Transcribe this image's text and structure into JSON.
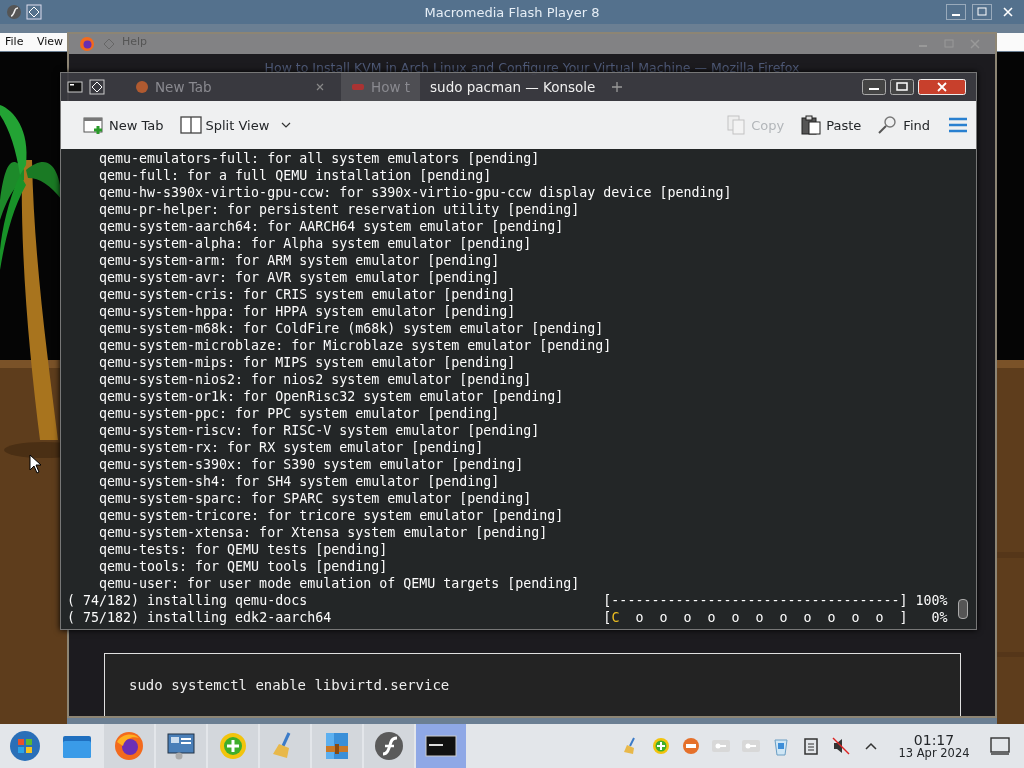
{
  "flash_window": {
    "title": "Macromedia Flash Player 8",
    "menu": [
      "File",
      "View",
      "Help"
    ]
  },
  "browser_window": {
    "title": "How to Install KVM in Arch Linux and Configure Your Virtual Machine — Mozilla Firefox",
    "code": "sudo systemctl enable libvirtd.service"
  },
  "terminal_window": {
    "title": "sudo pacman — Konsole",
    "background_tabs": [
      {
        "label": "New Tab",
        "selected": false
      },
      {
        "label": "How t",
        "selected": true
      }
    ],
    "toolbar": [
      {
        "label": "New Tab",
        "kind": "new-tab",
        "disabled": false
      },
      {
        "label": "Split View",
        "kind": "split-view",
        "disabled": false
      },
      {
        "label": "Copy",
        "kind": "copy",
        "disabled": true
      },
      {
        "label": "Paste",
        "kind": "paste",
        "disabled": false
      },
      {
        "label": "Find",
        "kind": "find",
        "disabled": false
      }
    ],
    "lines": [
      "qemu-emulators-full: for all system emulators [pending]",
      "qemu-full: for a full QEMU installation [pending]",
      "qemu-hw-s390x-virtio-gpu-ccw: for s390x-virtio-gpu-ccw display device [pending]",
      "qemu-pr-helper: for persistent reservation utility [pending]",
      "qemu-system-aarch64: for AARCH64 system emulator [pending]",
      "qemu-system-alpha: for Alpha system emulator [pending]",
      "qemu-system-arm: for ARM system emulator [pending]",
      "qemu-system-avr: for AVR system emulator [pending]",
      "qemu-system-cris: for CRIS system emulator [pending]",
      "qemu-system-hppa: for HPPA system emulator [pending]",
      "qemu-system-m68k: for ColdFire (m68k) system emulator [pending]",
      "qemu-system-microblaze: for Microblaze system emulator [pending]",
      "qemu-system-mips: for MIPS system emulator [pending]",
      "qemu-system-nios2: for nios2 system emulator [pending]",
      "qemu-system-or1k: for OpenRisc32 system emulator [pending]",
      "qemu-system-ppc: for PPC system emulator [pending]",
      "qemu-system-riscv: for RISC-V system emulator [pending]",
      "qemu-system-rx: for RX system emulator [pending]",
      "qemu-system-s390x: for S390 system emulator [pending]",
      "qemu-system-sh4: for SH4 system emulator [pending]",
      "qemu-system-sparc: for SPARC system emulator [pending]",
      "qemu-system-tricore: for tricore system emulator [pending]",
      "qemu-system-xtensa: for Xtensa system emulator [pending]",
      "qemu-tests: for QEMU tests [pending]",
      "qemu-tools: for QEMU tools [pending]",
      "qemu-user: for user mode emulation of QEMU targets [pending]"
    ],
    "progress": [
      {
        "text": "( 74/182) installing qemu-docs",
        "bar": [
          {
            "text": "[------------------------------------]",
            "kind": "plain"
          }
        ],
        "reading": "100%"
      },
      {
        "text": "( 75/182) installing edk2-aarch64",
        "bar": [
          {
            "text": "[",
            "kind": "plain"
          },
          {
            "text": "C",
            "kind": "pacman"
          },
          {
            "text": "  o  o  o  o  o  o  o  o  o  o  o  ]",
            "kind": "plain"
          }
        ],
        "reading": "0%"
      }
    ]
  },
  "taskbar": {
    "apps": [
      {
        "kind": "start",
        "running": false,
        "selected": false
      },
      {
        "kind": "files",
        "running": false,
        "selected": false
      },
      {
        "kind": "firefox",
        "running": true,
        "selected": false
      },
      {
        "kind": "monitor",
        "running": true,
        "selected": false
      },
      {
        "kind": "plus",
        "running": true,
        "selected": false
      },
      {
        "kind": "broom",
        "running": true,
        "selected": false
      },
      {
        "kind": "archive",
        "running": true,
        "selected": false
      },
      {
        "kind": "flash",
        "running": true,
        "selected": false
      },
      {
        "kind": "terminal",
        "running": true,
        "selected": true
      }
    ],
    "tray": [
      {
        "kind": "broom"
      },
      {
        "kind": "plus"
      },
      {
        "kind": "stop"
      },
      {
        "kind": "key"
      },
      {
        "kind": "key"
      },
      {
        "kind": "bin"
      },
      {
        "kind": "clipboard"
      },
      {
        "kind": "muted"
      },
      {
        "kind": "caret"
      }
    ],
    "time": "01:17",
    "date": "13 Apr 2024"
  }
}
